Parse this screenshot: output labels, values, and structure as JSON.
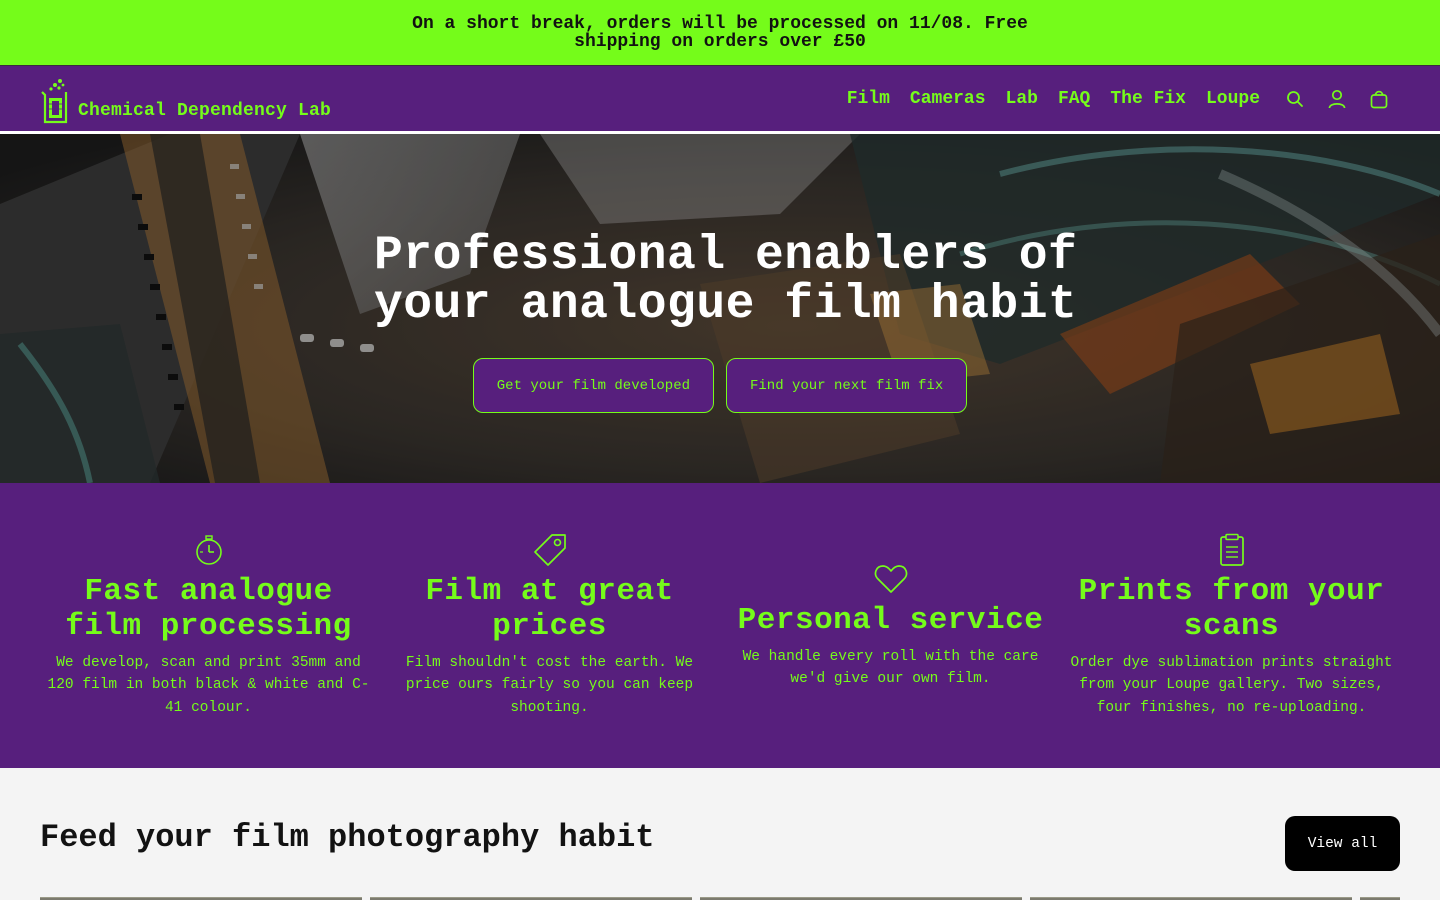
{
  "announcement": {
    "text": "On a short break, orders will be processed on 11/08. Free shipping on orders over £50"
  },
  "header": {
    "logo_text": "Chemical Dependency Lab",
    "nav": [
      {
        "label": "Film"
      },
      {
        "label": "Cameras"
      },
      {
        "label": "Lab"
      },
      {
        "label": "FAQ"
      },
      {
        "label": "The Fix"
      },
      {
        "label": "Loupe"
      }
    ],
    "icons": [
      "search-icon",
      "account-icon",
      "cart-icon"
    ]
  },
  "hero": {
    "title": "Professional enablers of your analogue film habit",
    "primary_button": "Get your film developed",
    "secondary_button": "Find your next film fix"
  },
  "features": [
    {
      "icon": "stopwatch-icon",
      "title": "Fast analogue film processing",
      "text": "We develop, scan and print 35mm and 120 film in both black & white and C-41 colour."
    },
    {
      "icon": "price-tag-icon",
      "title": "Film at great prices",
      "text": "Film shouldn't cost the earth. We price ours fairly so you can keep shooting."
    },
    {
      "icon": "heart-icon",
      "title": "Personal service",
      "text": "We handle every roll with the care we'd give our own film."
    },
    {
      "icon": "clipboard-icon",
      "title": "Prints from your scans",
      "text": "Order dye sublimation prints straight from your Loupe gallery. Two sizes, four finishes, no re-uploading."
    }
  ],
  "products": {
    "heading": "Feed your film photography habit",
    "view_all": "View all"
  },
  "colors": {
    "brand_purple": "#571f7d",
    "brand_green": "#75fc1a",
    "page_background": "#f4f4f4"
  }
}
